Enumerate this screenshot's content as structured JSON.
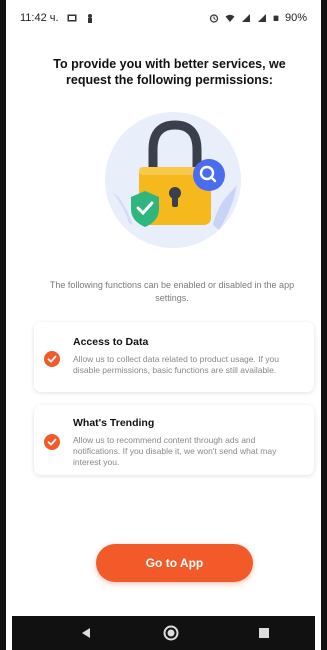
{
  "status": {
    "time": "11:42 ч.",
    "battery": "90%",
    "icons": [
      "image-icon",
      "person-icon",
      "alarm-icon",
      "wifi-icon",
      "signal-icon",
      "battery-icon"
    ]
  },
  "title": "To provide you with better services, we request the following permissions:",
  "subtitle": "The following functions can be enabled or disabled in the app settings.",
  "cards": [
    {
      "heading": "Access to Data",
      "body": "Allow us to collect data related to product usage. If you disable permissions, basic functions are still available."
    },
    {
      "heading": "What's Trending",
      "body": "Allow us to recommend content through ads and notifications. If you disable it, we won't send what may interest you."
    }
  ],
  "cta_label": "Go to App",
  "colors": {
    "accent": "#f25a2a",
    "lock_gold": "#f5b81d",
    "shield_green": "#2fb67e",
    "magnifier_blue": "#4a6cf0"
  },
  "nav": [
    "back-icon",
    "home-icon",
    "recents-icon"
  ]
}
